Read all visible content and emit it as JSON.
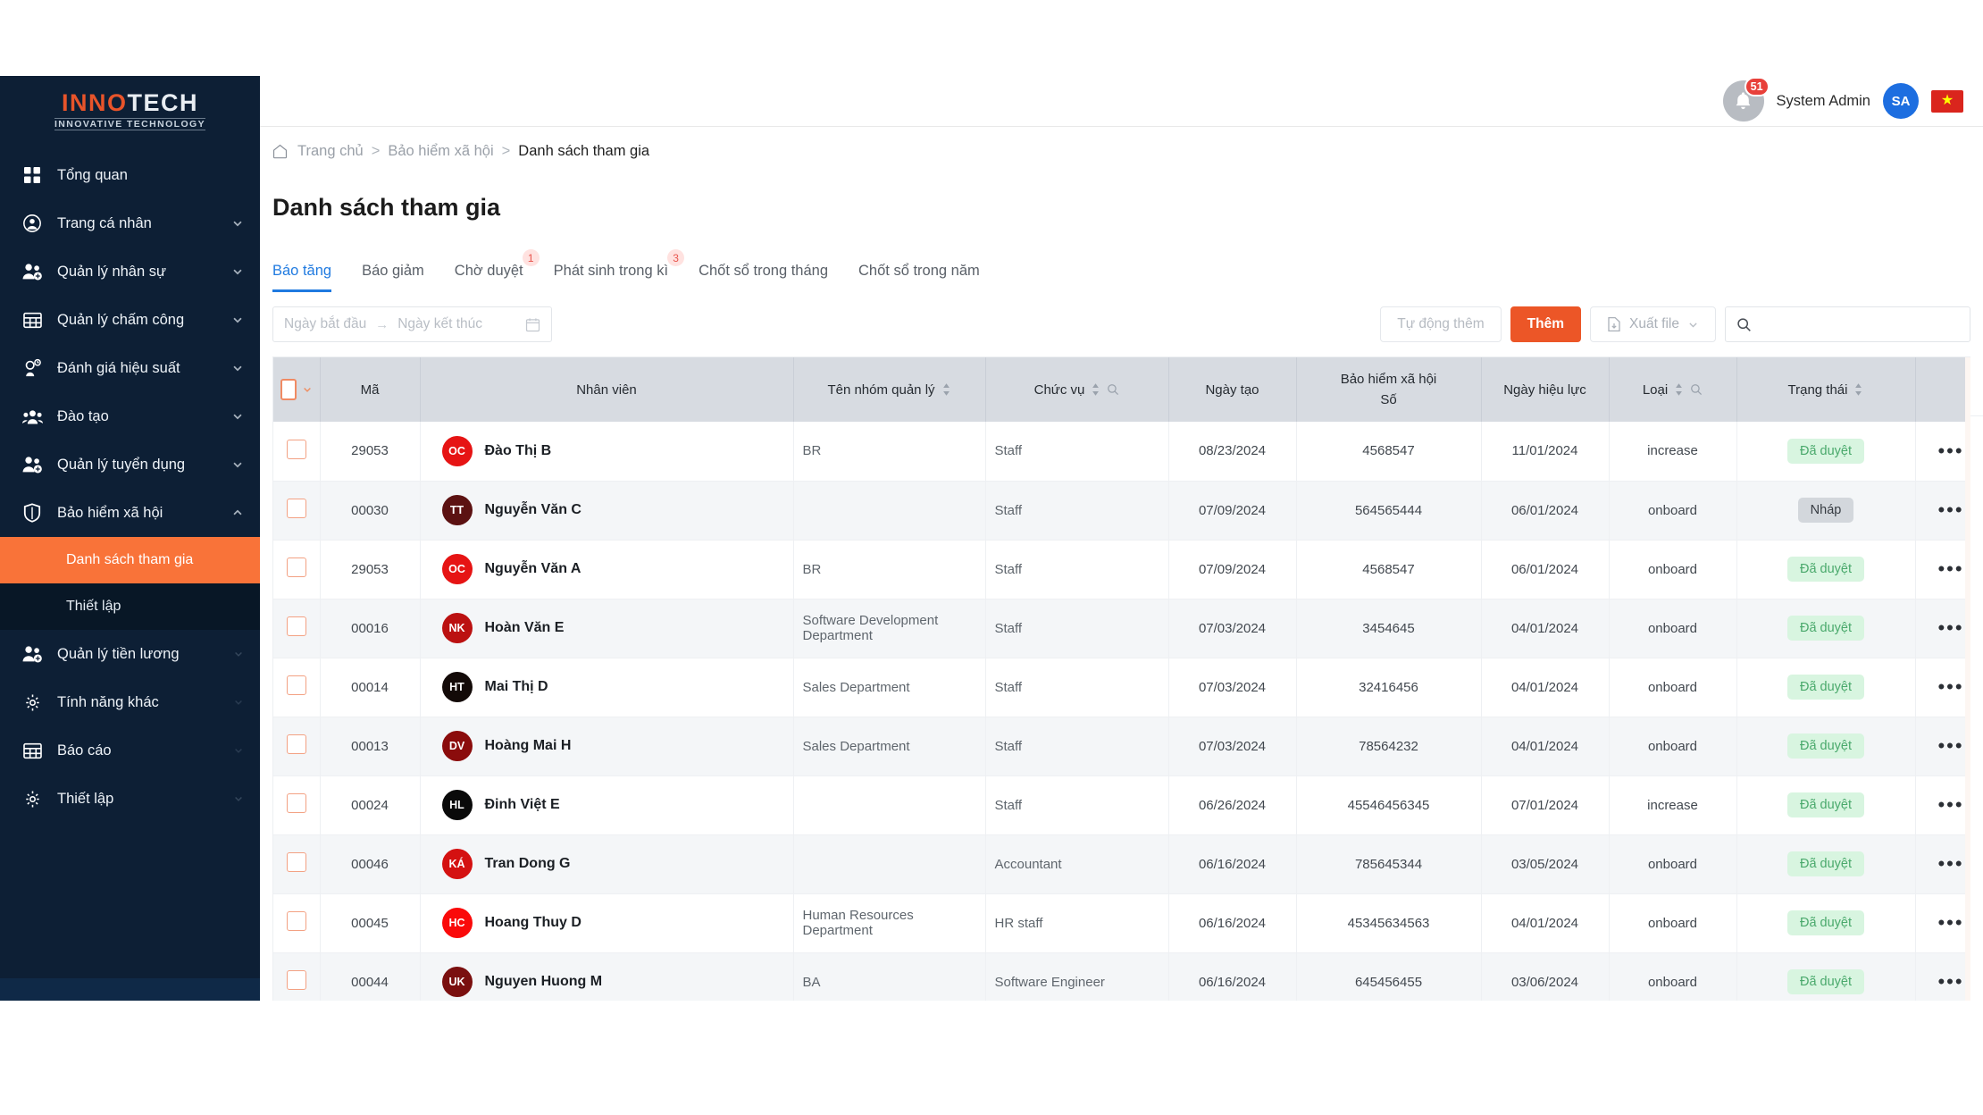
{
  "brand": {
    "logo_primary": "INNO",
    "logo_secondary": "TECH",
    "logo_tagline": "INNOVATIVE TECHNOLOGY"
  },
  "topbar": {
    "notification_count": "51",
    "user_name": "System Admin",
    "avatar_initials": "SA",
    "flag_glyph": "★"
  },
  "sidebar": {
    "items": [
      {
        "label": "Tổng quan",
        "icon": "grid-icon",
        "chevron": ""
      },
      {
        "label": "Trang cá nhân",
        "icon": "user-circle-icon",
        "chevron": "down"
      },
      {
        "label": "Quản lý nhân sự",
        "icon": "users-add-icon",
        "chevron": "down"
      },
      {
        "label": "Quản lý chấm công",
        "icon": "table-icon",
        "chevron": "down"
      },
      {
        "label": "Đánh giá hiệu suất",
        "icon": "performance-icon",
        "chevron": "down"
      },
      {
        "label": "Đào tạo",
        "icon": "group-icon",
        "chevron": "down"
      },
      {
        "label": "Quản lý tuyển dụng",
        "icon": "users-add-icon",
        "chevron": "down"
      },
      {
        "label": "Bảo hiểm xã hội",
        "icon": "shield-icon",
        "chevron": "up"
      }
    ],
    "subitems": [
      {
        "label": "Danh sách tham gia",
        "selected": true
      },
      {
        "label": "Thiết lập",
        "selected": false
      }
    ],
    "items_after": [
      {
        "label": "Quản lý tiền lương",
        "icon": "users-add-icon",
        "chevron": "down"
      },
      {
        "label": "Tính năng khác",
        "icon": "gear-icon",
        "chevron": "down"
      },
      {
        "label": "Báo cáo",
        "icon": "table-icon",
        "chevron": "down"
      },
      {
        "label": "Thiết lập",
        "icon": "gear-icon",
        "chevron": "down"
      }
    ]
  },
  "breadcrumb": {
    "home": "Trang chủ",
    "parent": "Bảo hiểm xã hội",
    "current": "Danh sách tham gia",
    "separator": ">"
  },
  "page": {
    "title": "Danh sách tham gia"
  },
  "tabs": [
    {
      "label": "Báo tăng",
      "count": "",
      "active": true
    },
    {
      "label": "Báo giảm",
      "count": "",
      "active": false
    },
    {
      "label": "Chờ duyệt",
      "count": "1",
      "active": false
    },
    {
      "label": "Phát sinh trong kì",
      "count": "3",
      "active": false
    },
    {
      "label": "Chốt sổ trong tháng",
      "count": "",
      "active": false
    },
    {
      "label": "Chốt sổ trong năm",
      "count": "",
      "active": false
    }
  ],
  "toolbar": {
    "date_start_placeholder": "Ngày bắt đầu",
    "date_end_placeholder": "Ngày kết thúc",
    "date_arrow": "→",
    "auto_add_label": "Tự động thêm",
    "add_label": "Thêm",
    "export_label": "Xuất file",
    "search_placeholder": "",
    "search_value": ""
  },
  "table": {
    "columns": [
      {
        "key": "check",
        "label": "",
        "sortable": false,
        "searchable": false
      },
      {
        "key": "code",
        "label": "Mã",
        "sortable": false,
        "searchable": false
      },
      {
        "key": "employee",
        "label": "Nhân viên",
        "sortable": false,
        "searchable": false
      },
      {
        "key": "group",
        "label": "Tên nhóm quản lý",
        "sortable": true,
        "searchable": false
      },
      {
        "key": "position",
        "label": "Chức vụ",
        "sortable": true,
        "searchable": true
      },
      {
        "key": "created",
        "label": "Ngày tạo",
        "sortable": false,
        "searchable": false
      },
      {
        "key": "social_no",
        "label": "Bảo hiểm xã hội\nSố",
        "label_line1": "Bảo hiểm xã hội",
        "label_line2": "Số",
        "sortable": false,
        "searchable": false
      },
      {
        "key": "effective",
        "label": "Ngày hiệu lực",
        "sortable": false,
        "searchable": false
      },
      {
        "key": "type",
        "label": "Loại",
        "sortable": true,
        "searchable": true
      },
      {
        "key": "status",
        "label": "Trạng thái",
        "sortable": true,
        "searchable": false
      },
      {
        "key": "actions",
        "label": "",
        "sortable": false,
        "searchable": false
      }
    ],
    "rows": [
      {
        "code": "29053",
        "initials": "OC",
        "avatar_color": "#e61414",
        "name": "Đào Thị B",
        "group": "BR",
        "position": "Staff",
        "created": "08/23/2024",
        "social_no": "4568547",
        "effective": "11/01/2024",
        "type": "increase",
        "status": "Đã duyệt",
        "status_kind": "approved"
      },
      {
        "code": "00030",
        "initials": "TT",
        "avatar_color": "#5c1212",
        "name": "Nguyễn Văn C",
        "group": "",
        "position": "Staff",
        "created": "07/09/2024",
        "social_no": "564565444",
        "effective": "06/01/2024",
        "type": "onboard",
        "status": "Nháp",
        "status_kind": "draft"
      },
      {
        "code": "29053",
        "initials": "OC",
        "avatar_color": "#e61414",
        "name": "Nguyễn Văn A",
        "group": "BR",
        "position": "Staff",
        "created": "07/09/2024",
        "social_no": "4568547",
        "effective": "06/01/2024",
        "type": "onboard",
        "status": "Đã duyệt",
        "status_kind": "approved"
      },
      {
        "code": "00016",
        "initials": "NK",
        "avatar_color": "#bb1111",
        "name": "Hoàn Văn E",
        "group": "Software Development Department",
        "position": "Staff",
        "created": "07/03/2024",
        "social_no": "3454645",
        "effective": "04/01/2024",
        "type": "onboard",
        "status": "Đã duyệt",
        "status_kind": "approved"
      },
      {
        "code": "00014",
        "initials": "HT",
        "avatar_color": "#130a08",
        "name": "Mai Thị D",
        "group": "Sales Department",
        "position": "Staff",
        "created": "07/03/2024",
        "social_no": "32416456",
        "effective": "04/01/2024",
        "type": "onboard",
        "status": "Đã duyệt",
        "status_kind": "approved"
      },
      {
        "code": "00013",
        "initials": "DV",
        "avatar_color": "#8b0c0c",
        "name": "Hoàng Mai H",
        "group": "Sales Department",
        "position": "Staff",
        "created": "07/03/2024",
        "social_no": "78564232",
        "effective": "04/01/2024",
        "type": "onboard",
        "status": "Đã duyệt",
        "status_kind": "approved"
      },
      {
        "code": "00024",
        "initials": "HL",
        "avatar_color": "#0a0a0a",
        "name": "Đinh Việt E",
        "group": "",
        "position": "Staff",
        "created": "06/26/2024",
        "social_no": "45546456345",
        "effective": "07/01/2024",
        "type": "increase",
        "status": "Đã duyệt",
        "status_kind": "approved"
      },
      {
        "code": "00046",
        "initials": "KÁ",
        "avatar_color": "#d41111",
        "name": "Tran Dong G",
        "group": "",
        "position": "Accountant",
        "created": "06/16/2024",
        "social_no": "785645344",
        "effective": "03/05/2024",
        "type": "onboard",
        "status": "Đã duyệt",
        "status_kind": "approved"
      },
      {
        "code": "00045",
        "initials": "HC",
        "avatar_color": "#fa0a0a",
        "name": "Hoang Thuy D",
        "group": "Human Resources Department",
        "position": "HR staff",
        "created": "06/16/2024",
        "social_no": "45345634563",
        "effective": "04/01/2024",
        "type": "onboard",
        "status": "Đã duyệt",
        "status_kind": "approved"
      },
      {
        "code": "00044",
        "initials": "UK",
        "avatar_color": "#7a0f0f",
        "name": "Nguyen Huong M",
        "group": "BA",
        "position": "Software Engineer",
        "created": "06/16/2024",
        "social_no": "645456455",
        "effective": "03/06/2024",
        "type": "onboard",
        "status": "Đã duyệt",
        "status_kind": "approved"
      }
    ],
    "row_action_glyph": "•••"
  },
  "colors": {
    "accent": "#ec5627",
    "sidebar_bg": "#0d1f35",
    "tab_active": "#1f7ae0",
    "badge_approved_bg": "#d8f5e0",
    "badge_approved_fg": "#4aa96c",
    "badge_draft_bg": "#d3d7dc"
  }
}
